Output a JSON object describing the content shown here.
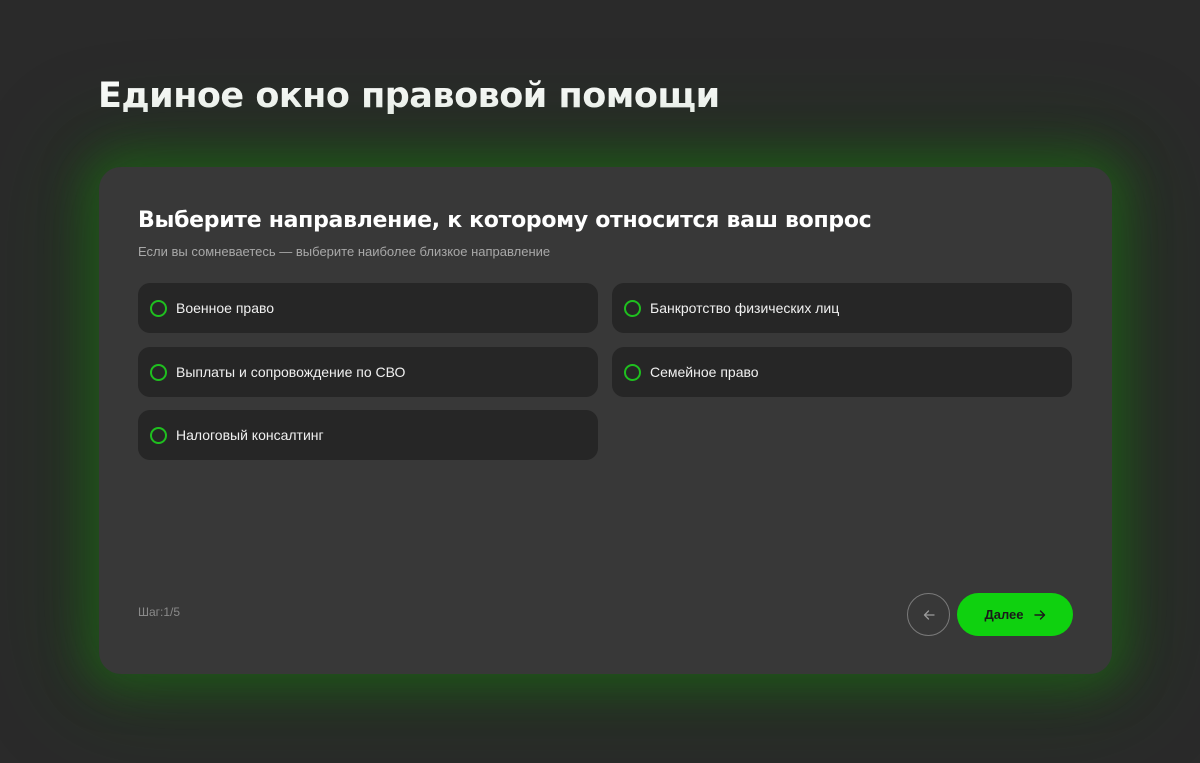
{
  "page": {
    "title": "Единое окно правовой помощи"
  },
  "form": {
    "heading": "Выберите направление, к которому относится ваш вопрос",
    "hint": "Если вы сомневаетесь — выберите наиболее близкое направление",
    "options": [
      {
        "label": "Военное право"
      },
      {
        "label": "Банкротство физических лиц"
      },
      {
        "label": "Выплаты и сопровождение по СВО"
      },
      {
        "label": "Семейное право"
      },
      {
        "label": "Налоговый консалтинг"
      }
    ],
    "step": "Шаг:1/5",
    "back_icon": "arrow-left-icon",
    "next_label": "Далее",
    "next_icon": "arrow-right-icon"
  },
  "colors": {
    "background": "#2a2a2a",
    "card": "#383838",
    "option": "#262626",
    "accent": "#0fd10f",
    "radio_border": "#1fbf1f"
  }
}
